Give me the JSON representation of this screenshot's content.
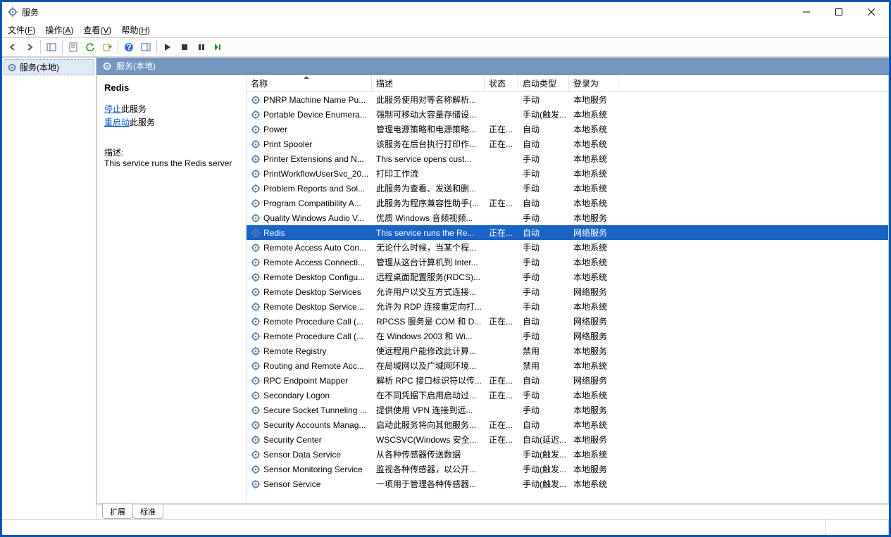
{
  "window": {
    "title": "服务"
  },
  "menu": {
    "file": "文件(F)",
    "action": "操作(A)",
    "view": "查看(V)",
    "help": "帮助(H)"
  },
  "tree": {
    "root": "服务(本地)"
  },
  "mainheader": "服务(本地)",
  "detail": {
    "title": "Redis",
    "stop_link": "停止",
    "stop_suffix": "此服务",
    "restart_link": "重启动",
    "restart_suffix": "此服务",
    "desc_label": "描述:",
    "desc": "This service runs the Redis server"
  },
  "columns": {
    "name": "名称",
    "desc": "描述",
    "status": "状态",
    "startup": "启动类型",
    "logon": "登录为"
  },
  "rows": [
    {
      "n": "PNRP Machine Name Pu...",
      "d": "此服务使用对等名称解析...",
      "s": "",
      "t": "手动",
      "l": "本地服务"
    },
    {
      "n": "Portable Device Enumera...",
      "d": "强制可移动大容量存储设...",
      "s": "",
      "t": "手动(触发...",
      "l": "本地系统"
    },
    {
      "n": "Power",
      "d": "管理电源策略和电源策略...",
      "s": "正在...",
      "t": "自动",
      "l": "本地系统"
    },
    {
      "n": "Print Spooler",
      "d": "该服务在后台执行打印作...",
      "s": "正在...",
      "t": "自动",
      "l": "本地系统"
    },
    {
      "n": "Printer Extensions and N...",
      "d": "This service opens cust...",
      "s": "",
      "t": "手动",
      "l": "本地系统"
    },
    {
      "n": "PrintWorkflowUserSvc_20...",
      "d": "打印工作流",
      "s": "",
      "t": "手动",
      "l": "本地系统"
    },
    {
      "n": "Problem Reports and Sol...",
      "d": "此服务为查看、发送和删...",
      "s": "",
      "t": "手动",
      "l": "本地系统"
    },
    {
      "n": "Program Compatibility A...",
      "d": "此服务为程序兼容性助手(...",
      "s": "正在...",
      "t": "自动",
      "l": "本地系统"
    },
    {
      "n": "Quality Windows Audio V...",
      "d": "优质 Windows 音频视频...",
      "s": "",
      "t": "手动",
      "l": "本地服务"
    },
    {
      "n": "Redis",
      "d": "This service runs the Re...",
      "s": "正在...",
      "t": "自动",
      "l": "网络服务",
      "sel": true
    },
    {
      "n": "Remote Access Auto Con...",
      "d": "无论什么时候，当某个程...",
      "s": "",
      "t": "手动",
      "l": "本地系统"
    },
    {
      "n": "Remote Access Connecti...",
      "d": "管理从这台计算机到 Inter...",
      "s": "",
      "t": "手动",
      "l": "本地系统"
    },
    {
      "n": "Remote Desktop Configu...",
      "d": "远程桌面配置服务(RDCS)...",
      "s": "",
      "t": "手动",
      "l": "本地系统"
    },
    {
      "n": "Remote Desktop Services",
      "d": "允许用户以交互方式连接...",
      "s": "",
      "t": "手动",
      "l": "网络服务"
    },
    {
      "n": "Remote Desktop Service...",
      "d": "允许为 RDP 连接重定向打...",
      "s": "",
      "t": "手动",
      "l": "本地系统"
    },
    {
      "n": "Remote Procedure Call (...",
      "d": "RPCSS 服务是 COM 和 D...",
      "s": "正在...",
      "t": "自动",
      "l": "网络服务"
    },
    {
      "n": "Remote Procedure Call (...",
      "d": "在 Windows 2003 和 Wi...",
      "s": "",
      "t": "手动",
      "l": "网络服务"
    },
    {
      "n": "Remote Registry",
      "d": "使远程用户能修改此计算...",
      "s": "",
      "t": "禁用",
      "l": "本地服务"
    },
    {
      "n": "Routing and Remote Acc...",
      "d": "在局域网以及广域网环境...",
      "s": "",
      "t": "禁用",
      "l": "本地系统"
    },
    {
      "n": "RPC Endpoint Mapper",
      "d": "解析 RPC 接口标识符以传...",
      "s": "正在...",
      "t": "自动",
      "l": "网络服务"
    },
    {
      "n": "Secondary Logon",
      "d": "在不同凭据下启用启动过...",
      "s": "正在...",
      "t": "手动",
      "l": "本地系统"
    },
    {
      "n": "Secure Socket Tunneling ...",
      "d": "提供使用 VPN 连接到远...",
      "s": "",
      "t": "手动",
      "l": "本地服务"
    },
    {
      "n": "Security Accounts Manag...",
      "d": "启动此服务将向其他服务...",
      "s": "正在...",
      "t": "自动",
      "l": "本地系统"
    },
    {
      "n": "Security Center",
      "d": "WSCSVC(Windows 安全...",
      "s": "正在...",
      "t": "自动(延迟...",
      "l": "本地服务"
    },
    {
      "n": "Sensor Data Service",
      "d": "从各种传感器传送数据",
      "s": "",
      "t": "手动(触发...",
      "l": "本地系统"
    },
    {
      "n": "Sensor Monitoring Service",
      "d": "监视各种传感器，以公开...",
      "s": "",
      "t": "手动(触发...",
      "l": "本地服务"
    },
    {
      "n": "Sensor Service",
      "d": "一项用于管理各种传感器...",
      "s": "",
      "t": "手动(触发...",
      "l": "本地系统"
    }
  ],
  "tabs": {
    "extended": "扩展",
    "standard": "标准"
  }
}
